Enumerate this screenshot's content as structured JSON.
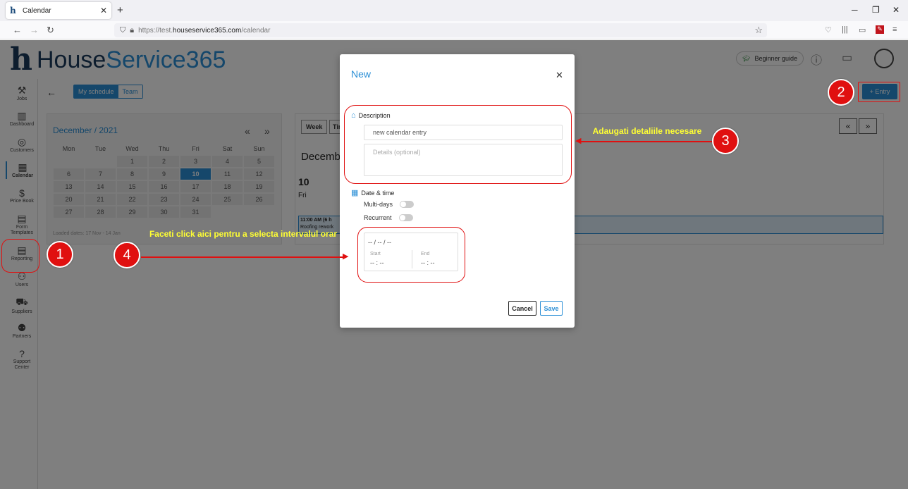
{
  "browser": {
    "tab_title": "Calendar",
    "url_prefix": "https://test.",
    "url_domain": "houseservice365.com",
    "url_path": "/calendar"
  },
  "app": {
    "logo_h": "h",
    "logo_part1": "House",
    "logo_part2": "Service365",
    "beginner_guide": "Beginner guide",
    "sidebar": [
      {
        "label": "Jobs",
        "icon": "tools-icon"
      },
      {
        "label": "Dashboard",
        "icon": "chart-icon"
      },
      {
        "label": "Customers",
        "icon": "target-icon"
      },
      {
        "label": "Calendar",
        "icon": "calendar-icon"
      },
      {
        "label": "Price Book",
        "icon": "price-icon"
      },
      {
        "label": "Form Templates",
        "icon": "form-icon"
      },
      {
        "label": "Reporting",
        "icon": "report-icon"
      },
      {
        "label": "Users",
        "icon": "users-icon"
      },
      {
        "label": "Suppliers",
        "icon": "truck-icon"
      },
      {
        "label": "Partners",
        "icon": "partners-icon"
      },
      {
        "label": "Support Center",
        "icon": "help-icon"
      }
    ],
    "my_schedule": "My schedule",
    "team": "Team",
    "entry_button": "+ Entry",
    "minical": {
      "title": "December / 2021",
      "days": [
        "Mon",
        "Tue",
        "Wed",
        "Thu",
        "Fri",
        "Sat",
        "Sun"
      ],
      "weeks": [
        [
          "",
          "",
          "1",
          "2",
          "3",
          "4",
          "5"
        ],
        [
          "6",
          "7",
          "8",
          "9",
          "10",
          "11",
          "12"
        ],
        [
          "13",
          "14",
          "15",
          "16",
          "17",
          "18",
          "19"
        ],
        [
          "20",
          "21",
          "22",
          "23",
          "24",
          "25",
          "26"
        ],
        [
          "27",
          "28",
          "29",
          "30",
          "31",
          "",
          ""
        ]
      ],
      "today": "10",
      "loaded": "Loaded dates: 17 Nov - 14 Jan"
    },
    "calendar": {
      "week_button": "Week",
      "second_button": "Tir",
      "title": "December",
      "day_num": "10",
      "day_name": "Fri",
      "event_time": "11:00 AM (6 h",
      "event_desc": "Roofing rework"
    }
  },
  "modal": {
    "title": "New",
    "description_label": "Description",
    "description_value": "new calendar entry",
    "details_placeholder": "Details (optional)",
    "datetime_label": "Date & time",
    "multidays_label": "Multi-days",
    "recurrent_label": "Recurrent",
    "date_value": "-- / -- / --",
    "start_label": "Start",
    "start_value": "-- : --",
    "end_label": "End",
    "end_value": "-- : --",
    "cancel": "Cancel",
    "save": "Save"
  },
  "annotations": {
    "badge1": "1",
    "badge2": "2",
    "badge3": "3",
    "badge4": "4",
    "note3": "Adaugati detaliile necesare",
    "note4": "Faceti click aici pentru a selecta intervalul orar",
    "ring_color": "#e01010",
    "note_color": "#ffff33"
  }
}
